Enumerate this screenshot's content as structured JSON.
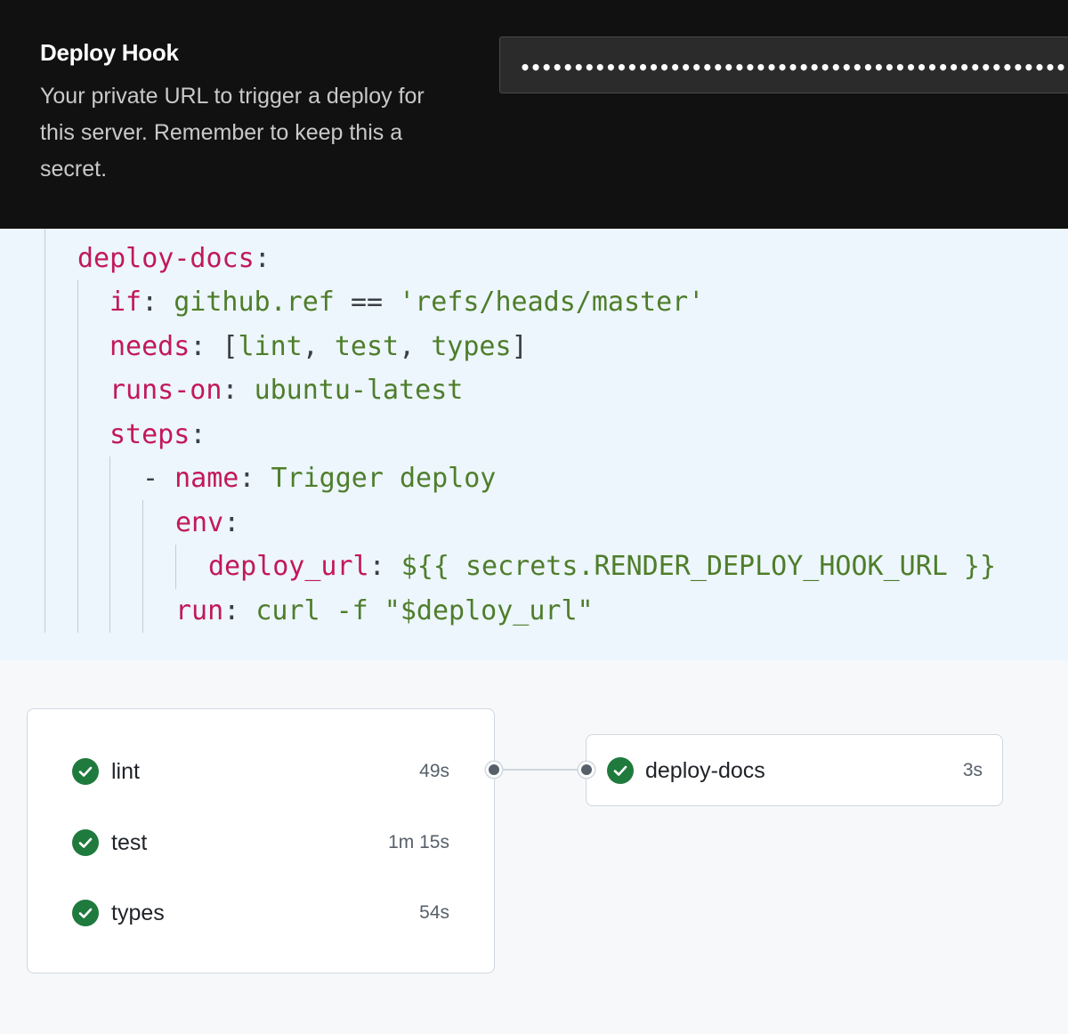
{
  "deploy_hook": {
    "title": "Deploy Hook",
    "description": "Your private URL to trigger a deploy for this server. Remember to keep this a secret.",
    "masked_value": "••••••••••••••••••••••••••••••••••••••••••••••••••••••••••••••••••"
  },
  "yaml": {
    "job_key": "deploy-docs",
    "if_key": "if",
    "if_value": "github.ref",
    "if_op": "==",
    "if_string": "'refs/heads/master'",
    "needs_key": "needs",
    "needs_open": "[",
    "needs_items": [
      "lint",
      "test",
      "types"
    ],
    "needs_close": "]",
    "runs_on_key": "runs-on",
    "runs_on_value": "ubuntu-latest",
    "steps_key": "steps",
    "dash": "-",
    "name_key": "name",
    "name_value": "Trigger deploy",
    "env_key": "env",
    "deploy_url_key": "deploy_url",
    "deploy_url_value": "${{ secrets.RENDER_DEPLOY_HOOK_URL }}",
    "run_key": "run",
    "run_value": "curl -f \"$deploy_url\""
  },
  "workflow": {
    "jobs": [
      {
        "name": "lint",
        "duration": "49s",
        "status": "success"
      },
      {
        "name": "test",
        "duration": "1m 15s",
        "status": "success"
      },
      {
        "name": "types",
        "duration": "54s",
        "status": "success"
      }
    ],
    "deploy_job": {
      "name": "deploy-docs",
      "duration": "3s",
      "status": "success"
    },
    "colors": {
      "success": "#1f7a3d",
      "border": "#d0d7de"
    }
  }
}
